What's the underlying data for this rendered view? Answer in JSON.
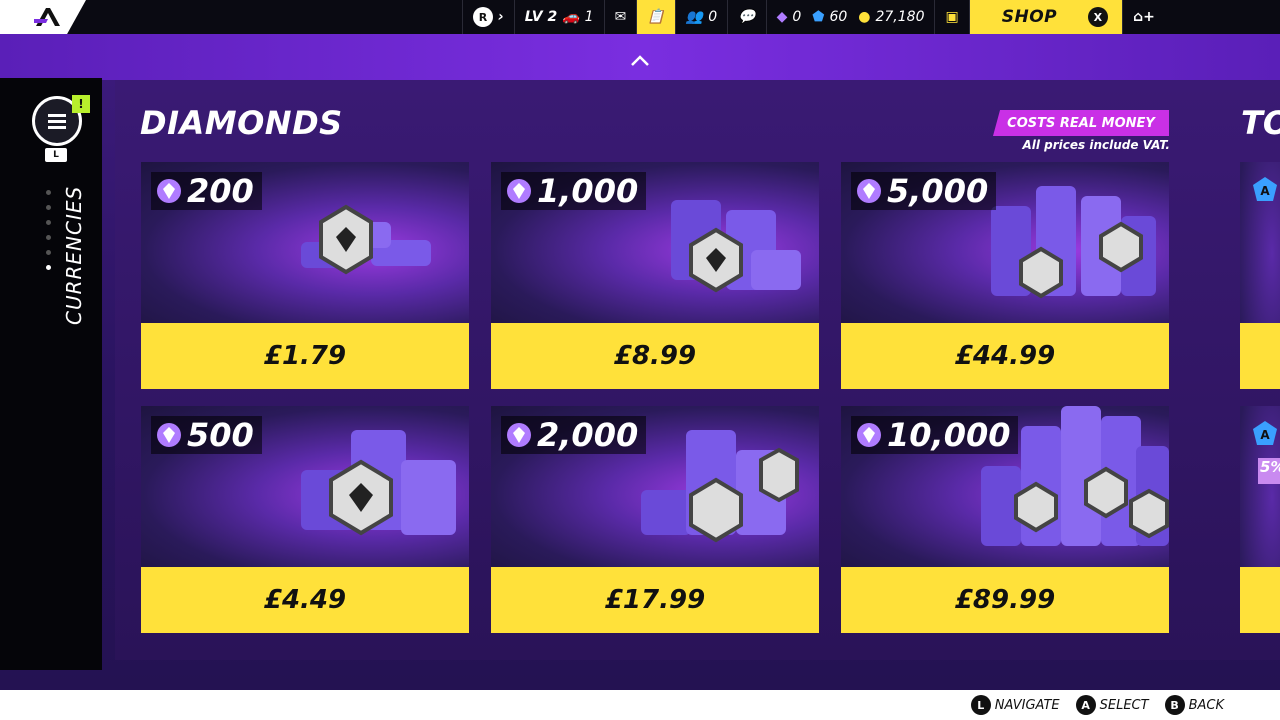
{
  "topbar": {
    "level_label": "LV 2",
    "cars_count": "1",
    "friends_count": "0",
    "diamonds": "0",
    "tokens": "60",
    "coins": "27,180",
    "shop_label": "SHOP",
    "close_key": "X"
  },
  "sidebar": {
    "alert_mark": "!",
    "menu_key": "L",
    "current_section": "CURRENCIES",
    "page_dot_count": 6,
    "active_dot_index": 5
  },
  "section": {
    "title": "DIAMONDS",
    "next_title": "TO",
    "costs_tag": "COSTS REAL MONEY",
    "vat_note": "All prices include VAT.",
    "next_discount": "5%"
  },
  "products": [
    {
      "amount": "200",
      "price": "£1.79"
    },
    {
      "amount": "1,000",
      "price": "£8.99"
    },
    {
      "amount": "5,000",
      "price": "£44.99"
    },
    {
      "amount": "500",
      "price": "£4.49"
    },
    {
      "amount": "2,000",
      "price": "£17.99"
    },
    {
      "amount": "10,000",
      "price": "£89.99"
    }
  ],
  "bottom_hints": {
    "navigate_key": "L",
    "navigate": "NAVIGATE",
    "select_key": "A",
    "select": "SELECT",
    "back_key": "B",
    "back": "BACK"
  },
  "colors": {
    "accent_yellow": "#ffe13a",
    "purple": "#7a2ee0",
    "magenta_tag": "#c930e6",
    "alert_green": "#b8ef2c"
  }
}
